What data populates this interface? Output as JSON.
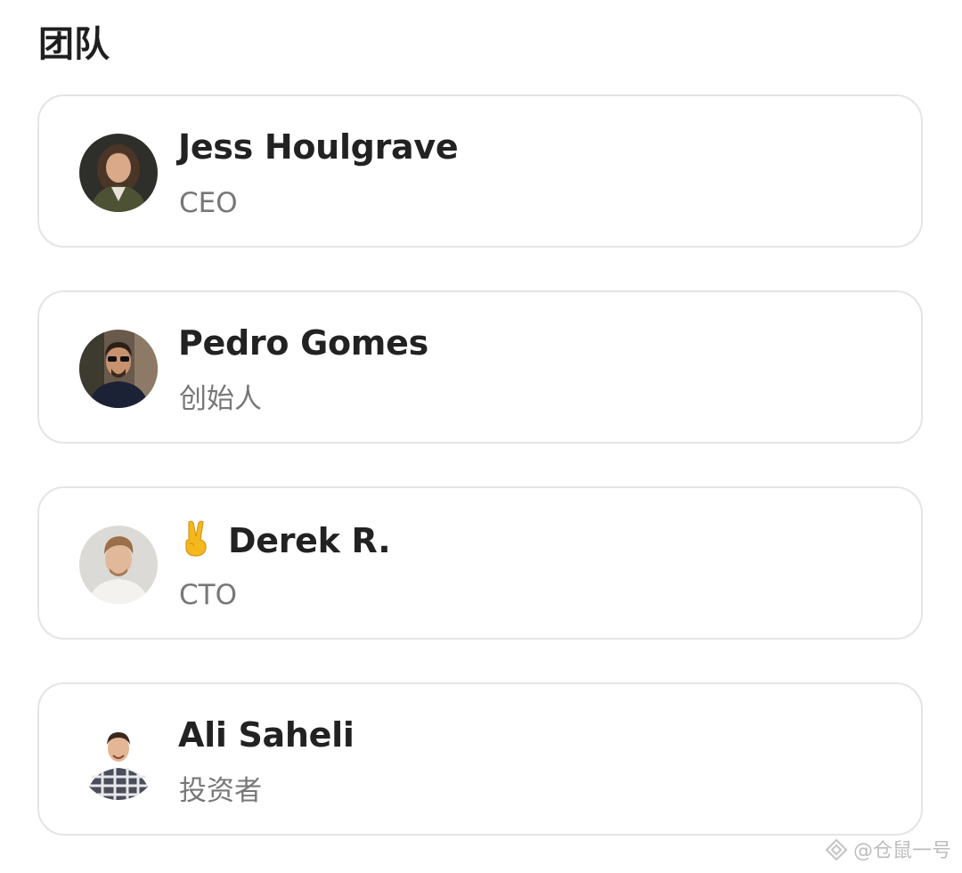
{
  "section": {
    "title": "团队"
  },
  "members": [
    {
      "name": "Jess Houlgrave",
      "role": "CEO",
      "avatar_icon": "person-woman-avatar"
    },
    {
      "name": "Pedro Gomes",
      "role": "创始人",
      "avatar_icon": "person-man-sunglasses-avatar"
    },
    {
      "name": "Derek R.",
      "name_emoji": "✌️",
      "role": "CTO",
      "avatar_icon": "person-man-avatar"
    },
    {
      "name": "Ali Saheli",
      "role": "投资者",
      "avatar_icon": "person-man-plaid-shirt-avatar"
    }
  ],
  "watermark": {
    "text": "@仓鼠一号"
  },
  "colors": {
    "card_border": "#e4e4e4",
    "name_text": "#222222",
    "role_text": "#777777"
  }
}
